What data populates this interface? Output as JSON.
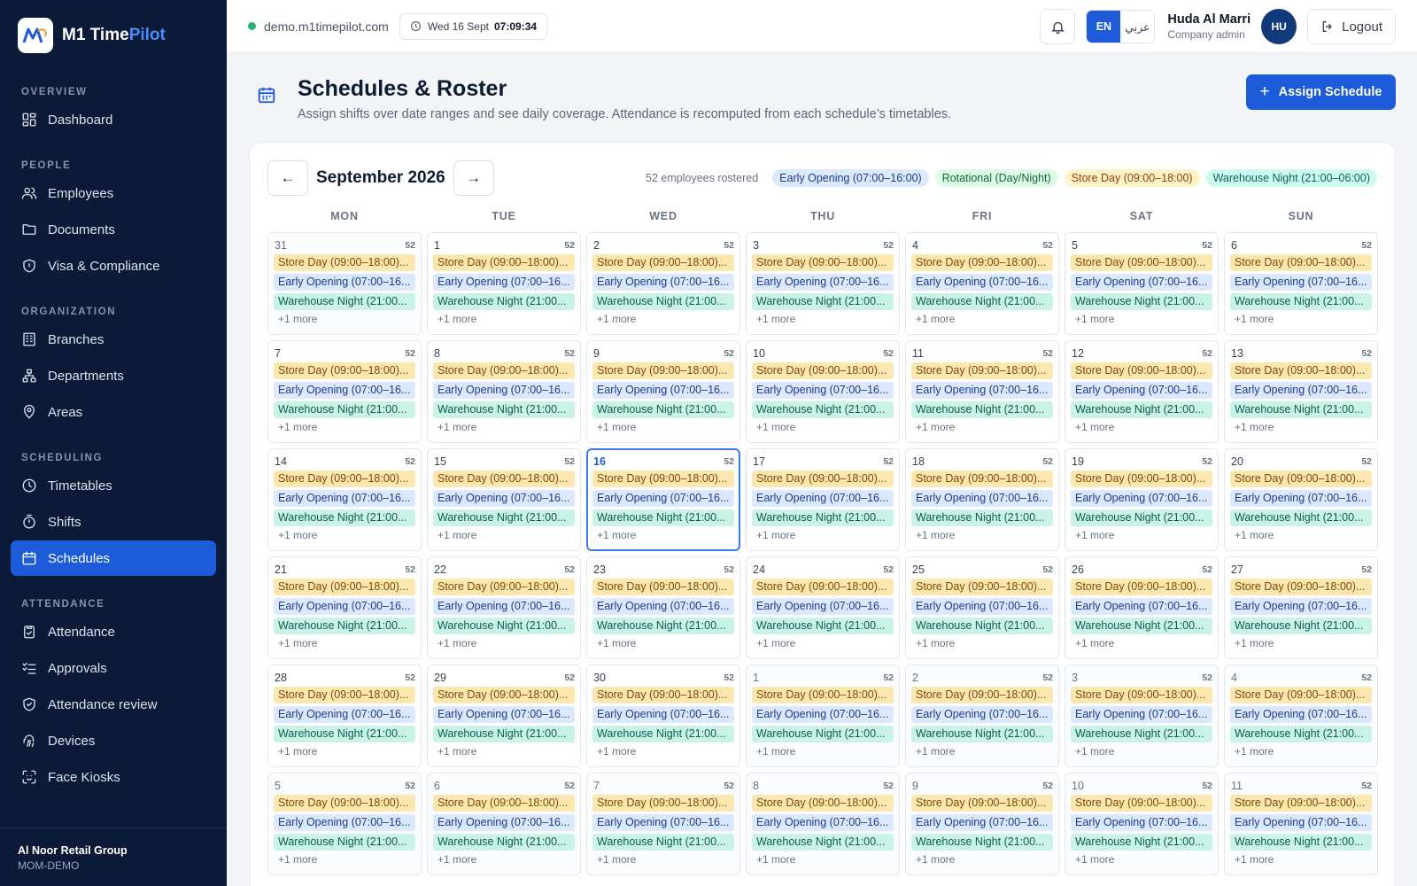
{
  "brand": {
    "name_main": "M1 Time",
    "name_accent": "Pilot"
  },
  "nav": [
    {
      "section": "OVERVIEW",
      "items": [
        {
          "label": "Dashboard",
          "icon": "dashboard-icon"
        }
      ]
    },
    {
      "section": "PEOPLE",
      "items": [
        {
          "label": "Employees",
          "icon": "users-icon"
        },
        {
          "label": "Documents",
          "icon": "folder-icon"
        },
        {
          "label": "Visa & Compliance",
          "icon": "shield-icon"
        }
      ]
    },
    {
      "section": "ORGANIZATION",
      "items": [
        {
          "label": "Branches",
          "icon": "building-icon"
        },
        {
          "label": "Departments",
          "icon": "org-chart-icon"
        },
        {
          "label": "Areas",
          "icon": "map-pin-icon"
        }
      ]
    },
    {
      "section": "SCHEDULING",
      "items": [
        {
          "label": "Timetables",
          "icon": "clock-icon"
        },
        {
          "label": "Shifts",
          "icon": "timer-icon"
        },
        {
          "label": "Schedules",
          "icon": "calendar-icon",
          "active": true
        }
      ]
    },
    {
      "section": "ATTENDANCE",
      "items": [
        {
          "label": "Attendance",
          "icon": "clipboard-check-icon"
        },
        {
          "label": "Approvals",
          "icon": "list-check-icon"
        },
        {
          "label": "Attendance review",
          "icon": "shield-check-icon"
        },
        {
          "label": "Devices",
          "icon": "fingerprint-icon"
        },
        {
          "label": "Face Kiosks",
          "icon": "face-scan-icon"
        }
      ]
    }
  ],
  "org": {
    "name": "Al Noor Retail Group",
    "code": "MOM-DEMO"
  },
  "topbar": {
    "domain": "demo.m1timepilot.com",
    "date": "Wed 16 Sept",
    "time": "07:09:34",
    "lang_en": "EN",
    "lang_ar": "عربي",
    "user_name": "Huda Al Marri",
    "user_role": "Company admin",
    "avatar": "HU",
    "logout": "Logout"
  },
  "page": {
    "title": "Schedules & Roster",
    "subtitle": "Assign shifts over date ranges and see daily coverage. Attendance is recomputed from each schedule’s timetables.",
    "assign_label": "Assign Schedule"
  },
  "calendar": {
    "prev": "←",
    "next": "→",
    "month": "September 2026",
    "rostered": "52 employees rostered",
    "legend": [
      {
        "label": "Early Opening (07:00–16:00)",
        "bg": "#dbeafe",
        "fg": "#1e3a8a"
      },
      {
        "label": "Rotational (Day/Night)",
        "bg": "#dcfce7",
        "fg": "#166534"
      },
      {
        "label": "Store Day (09:00–18:00)",
        "bg": "#fef3c7",
        "fg": "#92400e"
      },
      {
        "label": "Warehouse Night (21:00–06:00)",
        "bg": "#ccfbf1",
        "fg": "#115e59"
      }
    ],
    "weekdays": [
      "MON",
      "TUE",
      "WED",
      "THU",
      "FRI",
      "SAT",
      "SUN"
    ],
    "shift_labels": [
      "Store Day (09:00–18:00)...",
      "Early Opening (07:00–16...",
      "Warehouse Night (21:00..."
    ],
    "shift_colors": [
      {
        "bg": "#fde7b0",
        "fg": "#7c4a03"
      },
      {
        "bg": "#dbe8fd",
        "fg": "#1e3a8a"
      },
      {
        "bg": "#c9f3e6",
        "fg": "#0f5c4f"
      }
    ],
    "more_label": "+1 more",
    "count": "52",
    "today": "16",
    "days": [
      {
        "d": "31",
        "out": true
      },
      {
        "d": "1"
      },
      {
        "d": "2"
      },
      {
        "d": "3"
      },
      {
        "d": "4"
      },
      {
        "d": "5"
      },
      {
        "d": "6"
      },
      {
        "d": "7"
      },
      {
        "d": "8"
      },
      {
        "d": "9"
      },
      {
        "d": "10"
      },
      {
        "d": "11"
      },
      {
        "d": "12"
      },
      {
        "d": "13"
      },
      {
        "d": "14"
      },
      {
        "d": "15"
      },
      {
        "d": "16",
        "today": true
      },
      {
        "d": "17"
      },
      {
        "d": "18"
      },
      {
        "d": "19"
      },
      {
        "d": "20"
      },
      {
        "d": "21"
      },
      {
        "d": "22"
      },
      {
        "d": "23"
      },
      {
        "d": "24"
      },
      {
        "d": "25"
      },
      {
        "d": "26"
      },
      {
        "d": "27"
      },
      {
        "d": "28"
      },
      {
        "d": "29"
      },
      {
        "d": "30"
      },
      {
        "d": "1",
        "out": true
      },
      {
        "d": "2",
        "out": true
      },
      {
        "d": "3",
        "out": true
      },
      {
        "d": "4",
        "out": true
      },
      {
        "d": "5",
        "out": true
      },
      {
        "d": "6",
        "out": true
      },
      {
        "d": "7",
        "out": true
      },
      {
        "d": "8",
        "out": true
      },
      {
        "d": "9",
        "out": true
      },
      {
        "d": "10",
        "out": true
      },
      {
        "d": "11",
        "out": true
      }
    ]
  }
}
